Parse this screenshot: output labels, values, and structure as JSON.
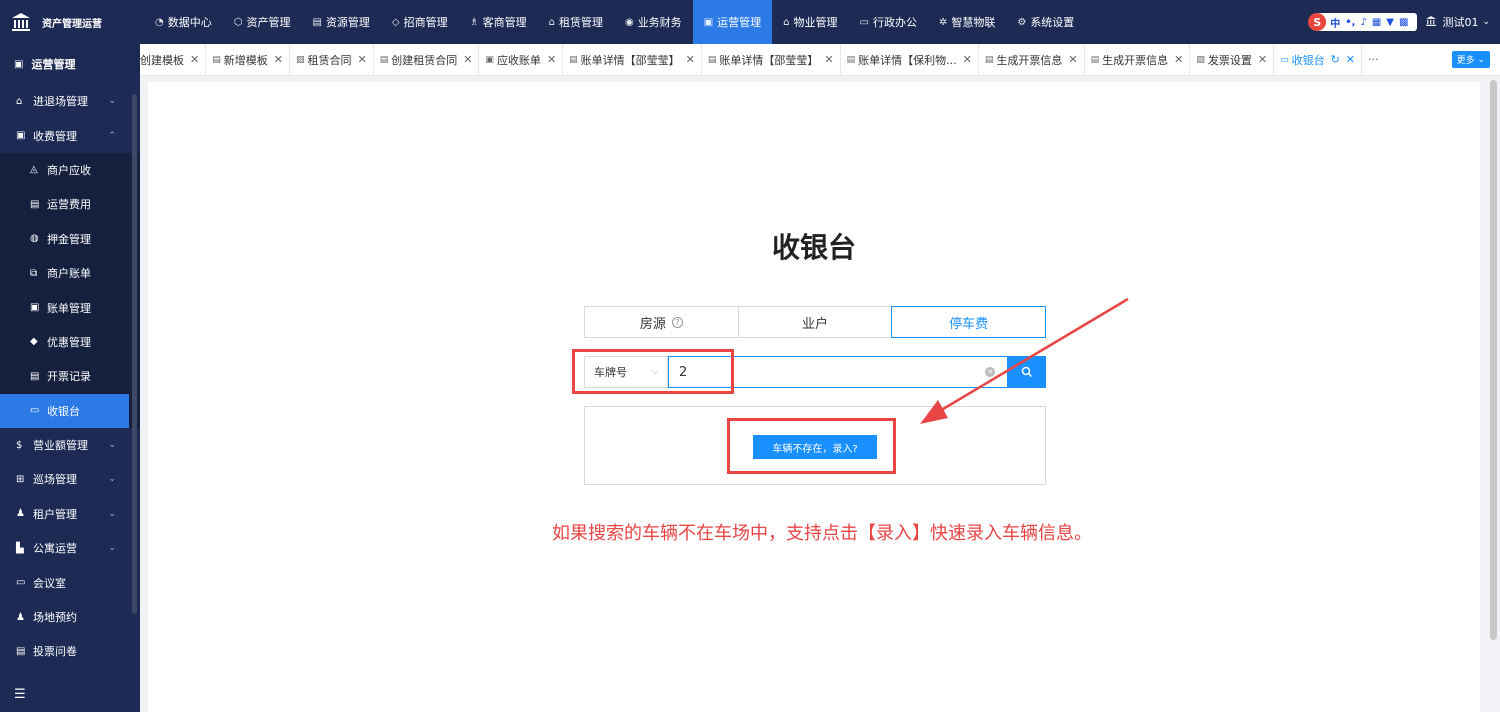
{
  "app": {
    "brand": "资产管理运营"
  },
  "topnav": [
    {
      "icon": "dashboard-icon",
      "glyph": "◔",
      "label": "数据中心"
    },
    {
      "icon": "cube-icon",
      "glyph": "⬡",
      "label": "资产管理"
    },
    {
      "icon": "doc-icon",
      "glyph": "▤",
      "label": "资源管理"
    },
    {
      "icon": "tag-icon",
      "glyph": "◇",
      "label": "招商管理"
    },
    {
      "icon": "users-icon",
      "glyph": "♗",
      "label": "客商管理"
    },
    {
      "icon": "house-icon",
      "glyph": "⌂",
      "label": "租赁管理"
    },
    {
      "icon": "coin-icon",
      "glyph": "◉",
      "label": "业务财务"
    },
    {
      "icon": "ops-icon",
      "glyph": "▣",
      "label": "运营管理"
    },
    {
      "icon": "building-icon",
      "glyph": "⌂",
      "label": "物业管理"
    },
    {
      "icon": "office-icon",
      "glyph": "▭",
      "label": "行政办公"
    },
    {
      "icon": "iot-icon",
      "glyph": "✲",
      "label": "智慧物联"
    },
    {
      "icon": "settings-icon",
      "glyph": "⚙",
      "label": "系统设置"
    }
  ],
  "topnav_active": 7,
  "ime": {
    "lang": "中"
  },
  "user": {
    "name": "测试01"
  },
  "sidebar": {
    "title": "运营管理",
    "items_top": [
      {
        "label": "进退场管理",
        "glyph": "⌂",
        "arrow": "⌄"
      },
      {
        "label": "收费管理",
        "glyph": "▣",
        "arrow": "⌃"
      }
    ],
    "sub": [
      {
        "label": "商户应收",
        "glyph": "◬"
      },
      {
        "label": "运营费用",
        "glyph": "▤"
      },
      {
        "label": "押金管理",
        "glyph": "◍"
      },
      {
        "label": "商户账单",
        "glyph": "⧉"
      },
      {
        "label": "账单管理",
        "glyph": "▣"
      },
      {
        "label": "优惠管理",
        "glyph": "◆"
      },
      {
        "label": "开票记录",
        "glyph": "▤"
      },
      {
        "label": "收银台",
        "glyph": "▭"
      }
    ],
    "items_bottom": [
      {
        "label": "营业额管理",
        "glyph": "$",
        "arrow": "⌄"
      },
      {
        "label": "巡场管理",
        "glyph": "⊞",
        "arrow": "⌄"
      },
      {
        "label": "租户管理",
        "glyph": "♟",
        "arrow": "⌄"
      },
      {
        "label": "公寓运营",
        "glyph": "▙",
        "arrow": "⌄"
      },
      {
        "label": "会议室",
        "glyph": "▭",
        "arrow": ""
      },
      {
        "label": "场地预约",
        "glyph": "♟",
        "arrow": ""
      },
      {
        "label": "投票问卷",
        "glyph": "▤",
        "arrow": ""
      }
    ]
  },
  "tabs": [
    {
      "label": "创建模板",
      "glyph": ""
    },
    {
      "label": "新增模板",
      "glyph": "▤"
    },
    {
      "label": "租赁合同",
      "glyph": "▨"
    },
    {
      "label": "创建租赁合同",
      "glyph": "▤"
    },
    {
      "label": "应收账单",
      "glyph": "▣"
    },
    {
      "label": "账单详情【邵莹莹】",
      "glyph": "▤"
    },
    {
      "label": "账单详情【邵莹莹】",
      "glyph": "▤"
    },
    {
      "label": "账单详情【保利物...",
      "glyph": "▤"
    },
    {
      "label": "生成开票信息",
      "glyph": "▤"
    },
    {
      "label": "生成开票信息",
      "glyph": "▤"
    },
    {
      "label": "发票设置",
      "glyph": "▨"
    },
    {
      "label": "收银台",
      "glyph": "▭"
    }
  ],
  "tabs_more": "更多",
  "page": {
    "title": "收银台",
    "type_tabs": [
      "房源",
      "业户",
      "停车费"
    ],
    "type_active": 2,
    "select_value": "车牌号",
    "search_value": "2",
    "add_button": "车辆不存在，录入?",
    "annotation": "如果搜索的车辆不在车场中，支持点击【录入】快速录入车辆信息。"
  },
  "colors": {
    "nav_bg": "#1d2b54",
    "accent": "#1890ff",
    "annotation": "#e84545"
  }
}
